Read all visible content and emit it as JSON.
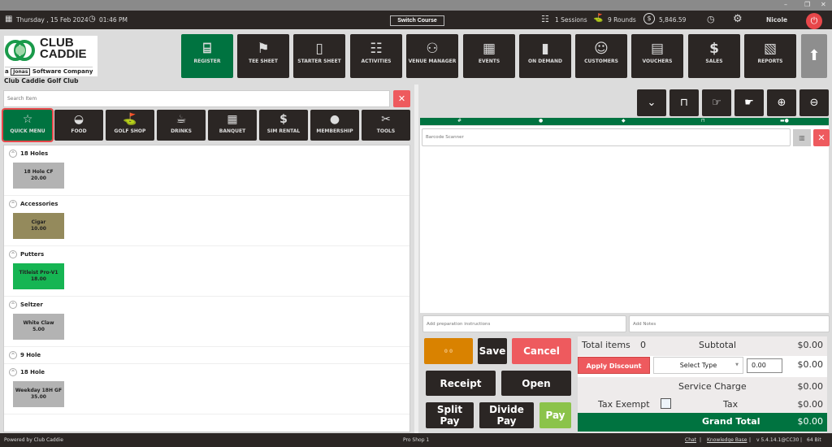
{
  "window": {
    "minimize": "–",
    "restore": "❐",
    "close": "✕"
  },
  "topbar": {
    "date": "Thursday ,  15 Feb 2024",
    "time": "01:46 PM",
    "switch_course": "Switch Course",
    "sessions": "1 Sessions",
    "rounds": "9 Rounds",
    "balance": "5,846.59",
    "user": "Nicole"
  },
  "logo": {
    "line1": "CLUB",
    "line2": "CADDIE",
    "tagline_a": "a",
    "tagline_brand": "Jonas",
    "tagline": "Software Company",
    "club_name": "Club Caddie Golf Club"
  },
  "nav": [
    {
      "label": "REGISTER",
      "icon": "barcode-scanner-icon",
      "glyph": "⌸"
    },
    {
      "label": "TEE SHEET",
      "icon": "tee-sheet-icon",
      "glyph": "⚑"
    },
    {
      "label": "STARTER SHEET",
      "icon": "tablet-icon",
      "glyph": "▯"
    },
    {
      "label": "ACTIVITIES",
      "icon": "calendar-list-icon",
      "glyph": "☷"
    },
    {
      "label": "VENUE MANAGER",
      "icon": "meeting-icon",
      "glyph": "⚇"
    },
    {
      "label": "EVENTS",
      "icon": "calendar-edit-icon",
      "glyph": "▦"
    },
    {
      "label": "ON DEMAND",
      "icon": "mobile-user-icon",
      "glyph": "▮"
    },
    {
      "label": "CUSTOMERS",
      "icon": "group-icon",
      "glyph": "☺"
    },
    {
      "label": "VOUCHERS",
      "icon": "voucher-icon",
      "glyph": "▤"
    },
    {
      "label": "SALES",
      "icon": "cash-icon",
      "glyph": "$"
    },
    {
      "label": "REPORTS",
      "icon": "report-icon",
      "glyph": "▧"
    }
  ],
  "search": {
    "placeholder": "Search Item"
  },
  "categories": [
    {
      "label": "QUICK MENU",
      "icon": "star-icon",
      "glyph": "☆"
    },
    {
      "label": "FOOD",
      "icon": "burger-icon",
      "glyph": "◒"
    },
    {
      "label": "GOLF SHOP",
      "icon": "golf-flag-icon",
      "glyph": "⛳"
    },
    {
      "label": "DRINKS",
      "icon": "beer-mug-icon",
      "glyph": "☕"
    },
    {
      "label": "BANQUET",
      "icon": "calendar-icon",
      "glyph": "▦"
    },
    {
      "label": "SIM RENTAL",
      "icon": "sim-rental-icon",
      "glyph": "$"
    },
    {
      "label": "MEMBERSHIP",
      "icon": "person-icon",
      "glyph": "●"
    },
    {
      "label": "TOOLS",
      "icon": "tools-icon",
      "glyph": "✂"
    }
  ],
  "groups": [
    {
      "title": "18 Holes",
      "items": [
        {
          "name": "18 Hole CF",
          "price": "20.00",
          "color": "#b3b3b3"
        }
      ]
    },
    {
      "title": "Accessories",
      "items": [
        {
          "name": "Cigar",
          "price": "10.00",
          "color": "#948a5c"
        }
      ]
    },
    {
      "title": "Putters",
      "items": [
        {
          "name": "Titleist Pro-V1",
          "price": "18.00",
          "color": "#16b553"
        }
      ]
    },
    {
      "title": "Seltzer",
      "items": [
        {
          "name": "White Claw",
          "price": "5.00",
          "color": "#b3b3b3"
        }
      ]
    },
    {
      "title": "9 Hole",
      "items": []
    },
    {
      "title": "18 Hole",
      "items": [
        {
          "name": "Weekday 18H GF",
          "price": "35.00",
          "color": "#b3b3b3"
        }
      ]
    }
  ],
  "cart": {
    "barcode_placeholder": "Barcode Scanner",
    "prep_placeholder": "Add preparation instructions",
    "notes_placeholder": "Add Notes"
  },
  "actions": {
    "counter": "0   0",
    "save": "Save",
    "cancel": "Cancel",
    "receipt": "Receipt",
    "open": "Open",
    "split_pay": "Split Pay",
    "divide_pay": "Divide Pay",
    "pay": "Pay"
  },
  "totals": {
    "total_items_label": "Total items",
    "total_items": "0",
    "subtotal_label": "Subtotal",
    "subtotal": "$0.00",
    "apply_discount": "Apply Discount",
    "select_type": "Select Type",
    "discount_value": "0.00",
    "discount": "$0.00",
    "service_charge_label": "Service Charge",
    "service_charge": "$0.00",
    "tax_exempt_label": "Tax Exempt",
    "tax_exempt": false,
    "tax_label": "Tax",
    "tax": "$0.00",
    "grand_total_label": "Grand Total",
    "grand_total": "$0.00"
  },
  "footer": {
    "powered": "Powered by Club Caddie",
    "location": "Pro Shop 1",
    "chat": "Chat",
    "kb": "Knowledge Base",
    "version": "v 5.4.14.1@CC30",
    "bits": "64 Bit"
  },
  "colors": {
    "brand_green": "#007340",
    "dark": "#2b2624",
    "danger": "#ee5a5e",
    "pay_green": "#8bc34a",
    "orange": "#d98200"
  }
}
